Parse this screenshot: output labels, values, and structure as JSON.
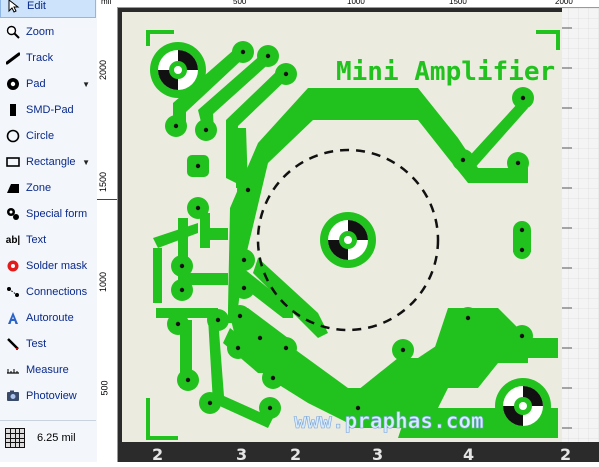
{
  "sidebar": {
    "tools": [
      {
        "label": "Edit",
        "icon": "pointer-icon"
      },
      {
        "label": "Zoom",
        "icon": "magnifier-icon"
      },
      {
        "label": "Track",
        "icon": "track-icon"
      },
      {
        "label": "Pad",
        "icon": "pad-icon",
        "dropdown": true
      },
      {
        "label": "SMD-Pad",
        "icon": "smd-pad-icon"
      },
      {
        "label": "Circle",
        "icon": "circle-icon"
      },
      {
        "label": "Rectangle",
        "icon": "rectangle-icon",
        "dropdown": true
      },
      {
        "label": "Zone",
        "icon": "zone-icon"
      },
      {
        "label": "Special form",
        "icon": "special-form-icon"
      },
      {
        "label": "Text",
        "icon": "text-icon",
        "icon_text": "ab|"
      },
      {
        "label": "Solder mask",
        "icon": "solder-mask-icon"
      },
      {
        "label": "Connections",
        "icon": "connections-icon"
      },
      {
        "label": "Autoroute",
        "icon": "autoroute-icon"
      },
      {
        "label": "Test",
        "icon": "test-icon"
      },
      {
        "label": "Measure",
        "icon": "measure-icon"
      },
      {
        "label": "Photoview",
        "icon": "photoview-icon"
      }
    ],
    "grid_value": "6.25 mil"
  },
  "ruler": {
    "unit": "mil",
    "top_labels": [
      "500",
      "1000",
      "1500",
      "2000"
    ],
    "left_labels": [
      "2000",
      "1500",
      "1000",
      "500"
    ]
  },
  "board": {
    "title": "Mini Amplifier",
    "watermark": "www.praphas.com",
    "track_color": "#22c21e",
    "board_color": "#ecebdf"
  },
  "bottom_strip": {
    "digits": [
      "2",
      "3",
      "2",
      "3",
      "4",
      "2"
    ]
  }
}
